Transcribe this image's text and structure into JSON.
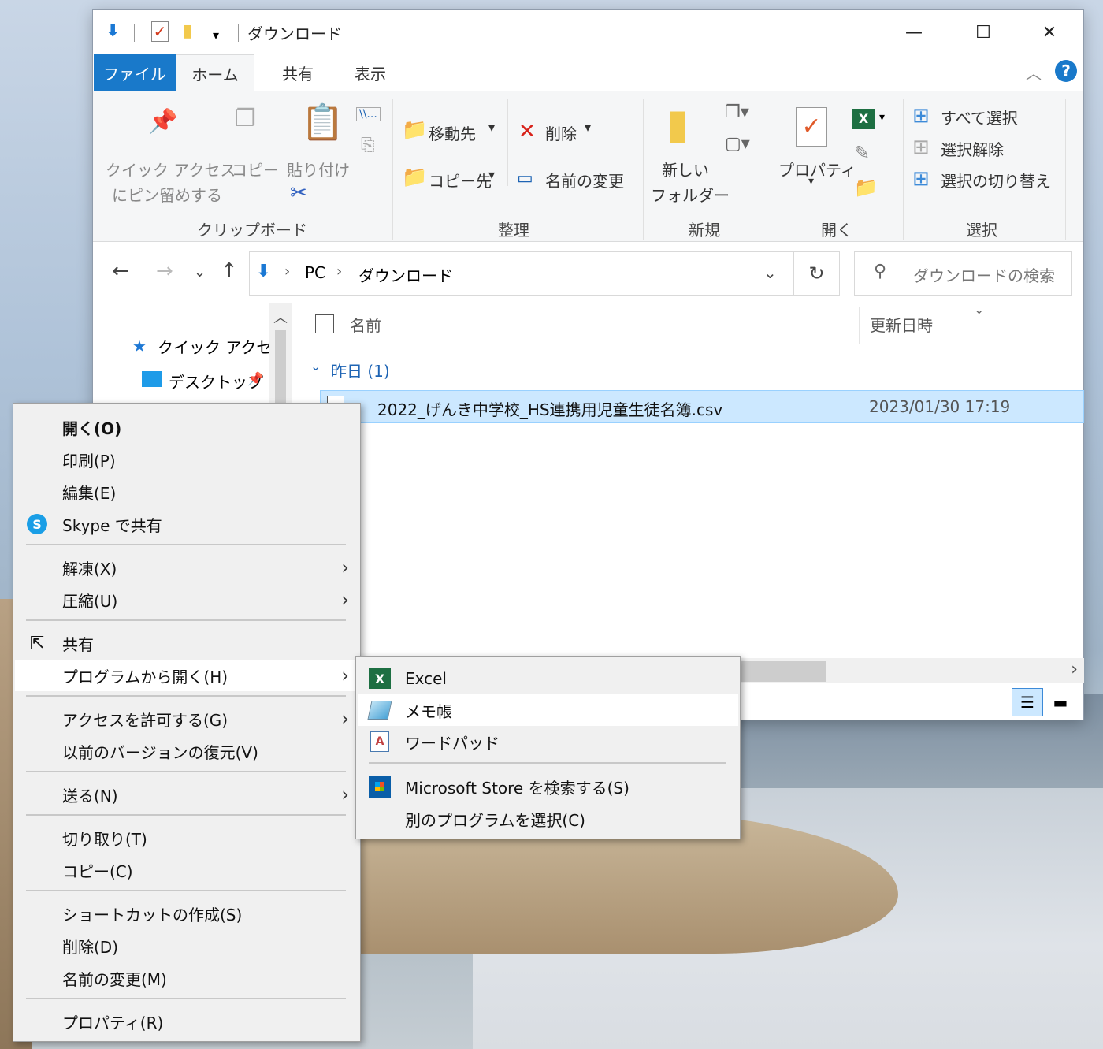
{
  "window": {
    "title": "ダウンロード",
    "tabs": {
      "file": "ファイル",
      "home": "ホーム",
      "share": "共有",
      "view": "表示"
    },
    "help": "?"
  },
  "ribbon": {
    "clipboard": {
      "pin": "クイック アクセス",
      "pin2": "にピン留めする",
      "copy": "コピー",
      "paste": "貼り付け",
      "label": "クリップボード"
    },
    "organize": {
      "move_to": "移動先",
      "copy_to": "コピー先",
      "delete": "削除",
      "rename": "名前の変更",
      "label": "整理"
    },
    "new": {
      "new_folder": "新しい",
      "new_folder2": "フォルダー",
      "label": "新規"
    },
    "open": {
      "properties": "プロパティ",
      "label": "開く"
    },
    "select": {
      "select_all": "すべて選択",
      "select_none": "選択解除",
      "invert": "選択の切り替え",
      "label": "選択"
    }
  },
  "address": {
    "pc": "PC",
    "downloads": "ダウンロード",
    "search_placeholder": "ダウンロードの検索"
  },
  "nav": {
    "quick_access": "クイック アクセス",
    "desktop": "デスクトップ"
  },
  "list": {
    "col_name": "名前",
    "col_date": "更新日時",
    "group": "昨日 (1)",
    "file_name": "2022_げんき中学校_HS連携用児童生徒名簿.csv",
    "file_date": "2023/01/30 17:19"
  },
  "context_menu": {
    "open": "開く(O)",
    "print": "印刷(P)",
    "edit": "編集(E)",
    "skype": "Skype で共有",
    "extract": "解凍(X)",
    "compress": "圧縮(U)",
    "share": "共有",
    "open_with": "プログラムから開く(H)",
    "grant_access": "アクセスを許可する(G)",
    "restore": "以前のバージョンの復元(V)",
    "send_to": "送る(N)",
    "cut": "切り取り(T)",
    "copy": "コピー(C)",
    "shortcut": "ショートカットの作成(S)",
    "delete": "削除(D)",
    "rename": "名前の変更(M)",
    "properties": "プロパティ(R)"
  },
  "submenu": {
    "excel": "Excel",
    "notepad": "メモ帳",
    "wordpad": "ワードパッド",
    "store": "Microsoft Store を検索する(S)",
    "choose": "別のプログラムを選択(C)"
  },
  "colors": {
    "accent": "#1979ca",
    "selection": "#cce8ff",
    "excel": "#1d6f42"
  }
}
